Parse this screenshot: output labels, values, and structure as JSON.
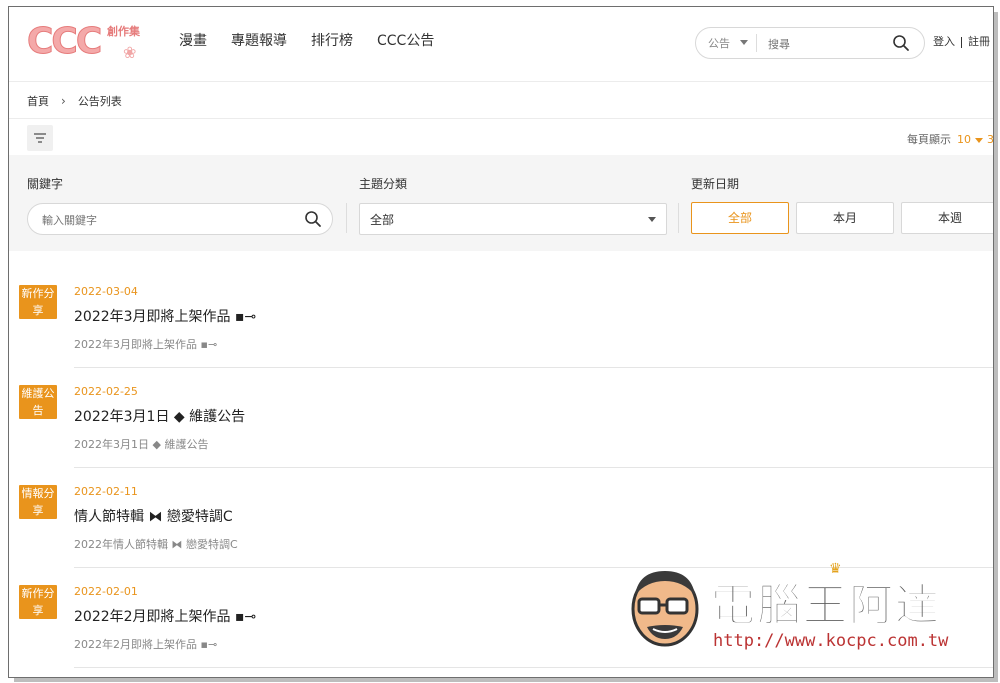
{
  "header": {
    "logo_text": "CCC",
    "logo_sub": "創作集",
    "nav": [
      "漫畫",
      "專題報導",
      "排行榜",
      "CCC公告"
    ],
    "search": {
      "category": "公告",
      "placeholder": "搜尋"
    },
    "login": "登入",
    "register": "註冊"
  },
  "breadcrumb": {
    "home": "首頁",
    "current": "公告列表"
  },
  "toolbar": {
    "per_page_label": "每頁顯示",
    "per_page_value": "10",
    "per_page_more": "3"
  },
  "filters": {
    "keyword_label": "關鍵字",
    "keyword_placeholder": "輸入關鍵字",
    "category_label": "主題分類",
    "category_value": "全部",
    "date_label": "更新日期",
    "date_options": [
      "全部",
      "本月",
      "本週"
    ]
  },
  "announcements": [
    {
      "badge_l1": "新作分",
      "badge_l2": "享",
      "date": "2022-03-04",
      "title": "2022年3月即將上架作品 ▪⊸",
      "desc": "2022年3月即將上架作品 ▪⊸"
    },
    {
      "badge_l1": "維護公",
      "badge_l2": "告",
      "date": "2022-02-25",
      "title": "2022年3月1日 ◆ 維護公告",
      "desc": "2022年3月1日 ◆ 維護公告"
    },
    {
      "badge_l1": "情報分",
      "badge_l2": "享",
      "date": "2022-02-11",
      "title": "情人節特輯 ⧓ 戀愛特調C",
      "desc": "2022年情人節特輯 ⧓ 戀愛特調C"
    },
    {
      "badge_l1": "新作分",
      "badge_l2": "享",
      "date": "2022-02-01",
      "title": "2022年2月即將上架作品 ▪⊸",
      "desc": "2022年2月即將上架作品 ▪⊸"
    }
  ],
  "watermark": {
    "title": "電腦王阿達",
    "url": "http://www.kocpc.com.tw"
  },
  "colors": {
    "accent": "#e9941c",
    "logo_pink": "#f4a9a9"
  }
}
